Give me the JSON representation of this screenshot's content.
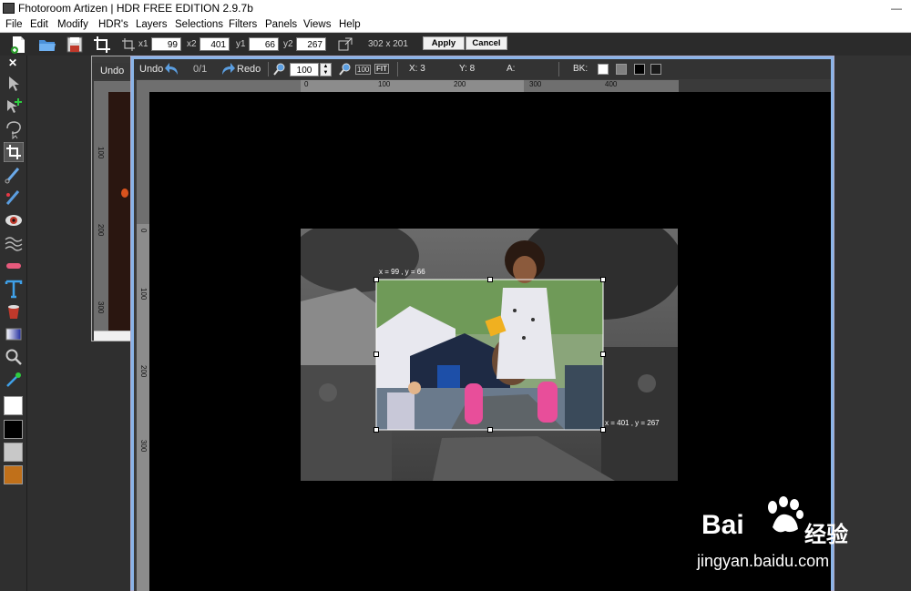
{
  "window": {
    "title": "Fhotoroom Artizen | HDR FREE EDITION 2.9.7b",
    "minimize_glyph": "—"
  },
  "menu": [
    "File",
    "Edit",
    "Modify",
    "HDR's",
    "Layers",
    "Selections",
    "Filters",
    "Panels",
    "Views",
    "Help"
  ],
  "crop": {
    "x1_label": "x1",
    "x1": "99",
    "x2_label": "x2",
    "x2": "401",
    "y1_label": "y1",
    "y1": "66",
    "y2_label": "y2",
    "y2": "267",
    "size": "302 x 201",
    "apply": "Apply",
    "cancel": "Cancel"
  },
  "tools_panel": {
    "close": "✕"
  },
  "back_window": {
    "undo": "Undo"
  },
  "doc": {
    "undo": "Undo",
    "history": "0/1",
    "redo": "Redo",
    "zoom": "100",
    "zoom_100": "100",
    "fit": "FIT",
    "x_label": "X: 3",
    "y_label": "Y: 8",
    "a_label": "A:",
    "bk_label": "BK:",
    "bk_colors": [
      "#ffffff",
      "#808080",
      "#000000",
      "#1a1a1a"
    ]
  },
  "ruler": {
    "h": [
      "0",
      "100",
      "200",
      "300",
      "400"
    ],
    "v": [
      "0",
      "100",
      "200",
      "300"
    ],
    "back_v": [
      "100",
      "200",
      "300"
    ]
  },
  "selection": {
    "start": "x = 99 , y = 66",
    "end": "x = 401 , y = 267"
  },
  "watermark": {
    "brand": "Bai",
    "brand2": "经验",
    "url": "jingyan.baidu.com"
  },
  "colors": {
    "accent_window_border": "#8ab4e8",
    "swatch_fg": "#ffffff",
    "swatch_bg": "#000000",
    "swatch_3": "#c8c8c8",
    "swatch_4": "#c0701a"
  }
}
